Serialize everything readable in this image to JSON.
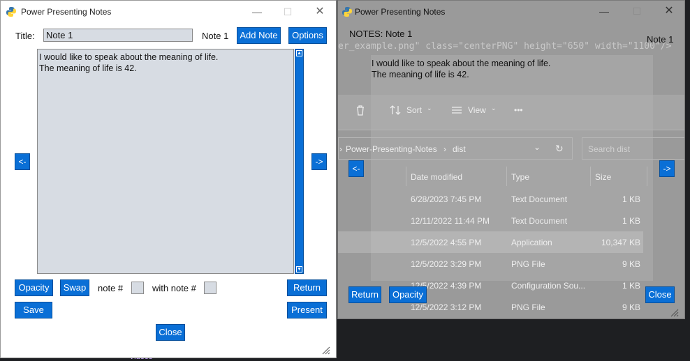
{
  "background": {
    "bottom_text": "Videos"
  },
  "editor_window": {
    "title": "Power Presenting Notes",
    "title_label": "Title:",
    "title_value": "Note 1",
    "note_indicator": "Note 1",
    "add_note_label": "Add Note",
    "options_label": "Options",
    "notes_line1": "I would like to speak about the meaning of life.",
    "notes_line2": "The meaning of life is 42.",
    "prev_label": "<-",
    "next_label": "->",
    "opacity_label": "Opacity",
    "swap_label": "Swap",
    "note_num_label": "note #",
    "with_note_num_label": "with note #",
    "return_label": "Return",
    "save_label": "Save",
    "present_label": "Present",
    "close_label": "Close"
  },
  "presenter_window": {
    "title": "Power Presenting Notes",
    "notes_heading": "NOTES: Note 1",
    "note_indicator": "Note 1",
    "notes_line1": "I would like to speak about the meaning of life.",
    "notes_line2": "The meaning of life is 42.",
    "prev_label": "<-",
    "next_label": "->",
    "return_label": "Return",
    "opacity_label": "Opacity",
    "close_label": "Close"
  },
  "behind_window": {
    "code_line": "er_example.png\" class=\"centerPNG\" height=\"650\" width=\"1100\"/>",
    "toolbar": {
      "sort": "Sort",
      "view": "View",
      "more": "•••"
    },
    "breadcrumb": [
      "Power-Presenting-Notes",
      "dist"
    ],
    "search_placeholder": "Search dist",
    "columns": [
      "Date modified",
      "Type",
      "Size"
    ],
    "rows": [
      {
        "date": "6/28/2023 7:45 PM",
        "type": "Text Document",
        "size": "1 KB"
      },
      {
        "date": "12/11/2022 11:44 PM",
        "type": "Text Document",
        "size": "1 KB"
      },
      {
        "date": "12/5/2022 4:55 PM",
        "type": "Application",
        "size": "10,347 KB"
      },
      {
        "date": "12/5/2022 3:29 PM",
        "type": "PNG File",
        "size": "9 KB"
      },
      {
        "date": "12/5/2022 4:39 PM",
        "type": "Configuration Sou...",
        "size": "1 KB"
      },
      {
        "date": "12/5/2022 3:12 PM",
        "type": "PNG File",
        "size": "9 KB"
      }
    ]
  },
  "colors": {
    "button_blue": "#0a6fd6",
    "field_gray": "#d7dce3",
    "presenter_bg": "#9a9a9a"
  }
}
